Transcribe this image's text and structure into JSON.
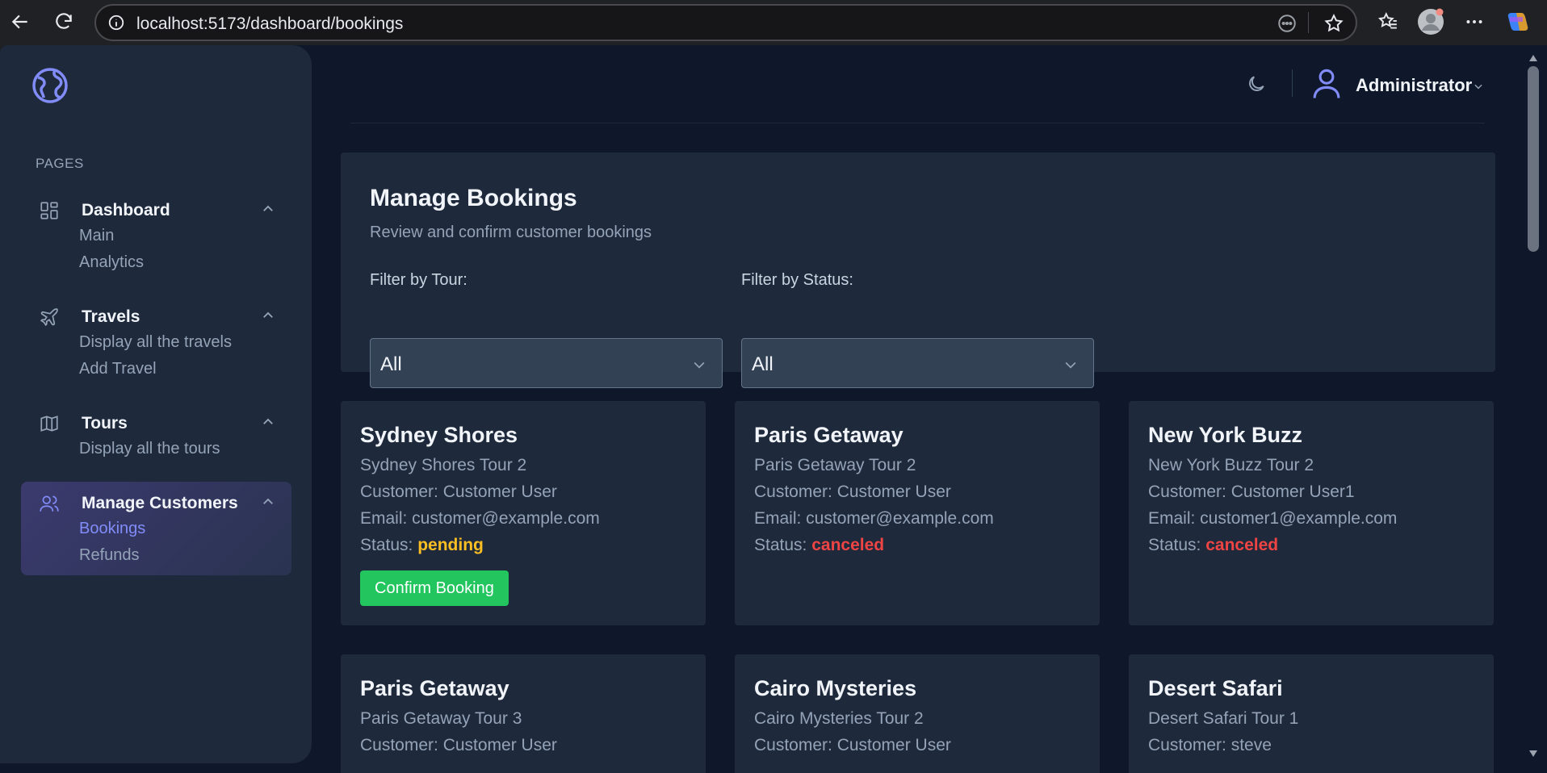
{
  "browser": {
    "url": "localhost:5173/dashboard/bookings"
  },
  "sidebar": {
    "section_label": "PAGES",
    "groups": [
      {
        "title": "Dashboard",
        "icon": "grid-icon",
        "items": [
          "Main",
          "Analytics"
        ]
      },
      {
        "title": "Travels",
        "icon": "plane-icon",
        "items": [
          "Display all the travels",
          "Add Travel"
        ]
      },
      {
        "title": "Tours",
        "icon": "map-icon",
        "items": [
          "Display all the tours"
        ]
      },
      {
        "title": "Manage Customers",
        "icon": "users-icon",
        "items": [
          "Bookings",
          "Refunds"
        ],
        "active_item": "Bookings"
      }
    ]
  },
  "topbar": {
    "user_name": "Administrator"
  },
  "header": {
    "title": "Manage Bookings",
    "subtitle": "Review and confirm customer bookings",
    "filter_tour_label": "Filter by Tour:",
    "filter_tour_value": "All",
    "filter_status_label": "Filter by Status:",
    "filter_status_value": "All"
  },
  "bookings": [
    {
      "title": "Sydney Shores",
      "tour": "Sydney Shores Tour 2",
      "customer": "Customer: Customer User",
      "email": "Email: customer@example.com",
      "status_label": "Status:",
      "status": "pending",
      "action": "Confirm Booking"
    },
    {
      "title": "Paris Getaway",
      "tour": "Paris Getaway Tour 2",
      "customer": "Customer: Customer User",
      "email": "Email: customer@example.com",
      "status_label": "Status:",
      "status": "canceled"
    },
    {
      "title": "New York Buzz",
      "tour": "New York Buzz Tour 2",
      "customer": "Customer: Customer User1",
      "email": "Email: customer1@example.com",
      "status_label": "Status:",
      "status": "canceled"
    },
    {
      "title": "Paris Getaway",
      "tour": "Paris Getaway Tour 3",
      "customer": "Customer: Customer User"
    },
    {
      "title": "Cairo Mysteries",
      "tour": "Cairo Mysteries Tour 2",
      "customer": "Customer: Customer User"
    },
    {
      "title": "Desert Safari",
      "tour": "Desert Safari Tour 1",
      "customer": "Customer: steve"
    }
  ],
  "colors": {
    "accent": "#818cf8",
    "pending": "#fbbf24",
    "canceled": "#ef4444",
    "confirm": "#22c55e"
  }
}
